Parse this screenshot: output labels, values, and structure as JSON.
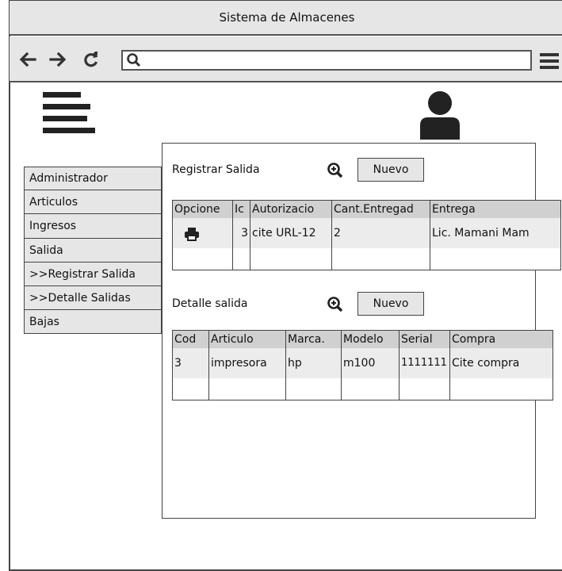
{
  "window": {
    "title": "Sistema de Almacenes"
  },
  "nav": {
    "back_icon": "arrow-left-icon",
    "forward_icon": "arrow-right-icon",
    "reload_icon": "reload-icon",
    "search_icon": "search-icon",
    "url_value": "",
    "menu_icon": "hamburger-menu-icon"
  },
  "header": {
    "menu_icon": "hamburger-menu-icon",
    "user_icon": "user-avatar-icon"
  },
  "sidebar": {
    "items": [
      {
        "label": "Administrador"
      },
      {
        "label": "Articulos"
      },
      {
        "label": "Ingresos"
      },
      {
        "label": "Salida"
      },
      {
        "label": ">>Registrar Salida"
      },
      {
        "label": ">>Detalle Salidas"
      },
      {
        "label": "Bajas"
      }
    ]
  },
  "registrar": {
    "title": "Registrar Salida",
    "zoom_icon": "zoom-in-icon",
    "new_button": "Nuevo",
    "columns": [
      "Opcione",
      "Ic",
      "Autorizacio",
      "Cant.Entregad",
      "Entrega"
    ],
    "rows": [
      {
        "option_icon": "printer-icon",
        "id": "3",
        "autorizacion": "cite URL-12",
        "cantidad": "2",
        "entrega": "Lic. Mamani Mam"
      }
    ]
  },
  "detalle": {
    "title": "Detalle salida",
    "zoom_icon": "zoom-in-icon",
    "new_button": "Nuevo",
    "columns": [
      "Cod",
      "Articulo",
      "Marca.",
      "Modelo",
      "Serial",
      "Compra"
    ],
    "rows": [
      {
        "cod": "3",
        "articulo": "impresora",
        "marca": "hp",
        "modelo": "m100",
        "serial": "1111111",
        "compra": "Cite compra"
      }
    ]
  }
}
